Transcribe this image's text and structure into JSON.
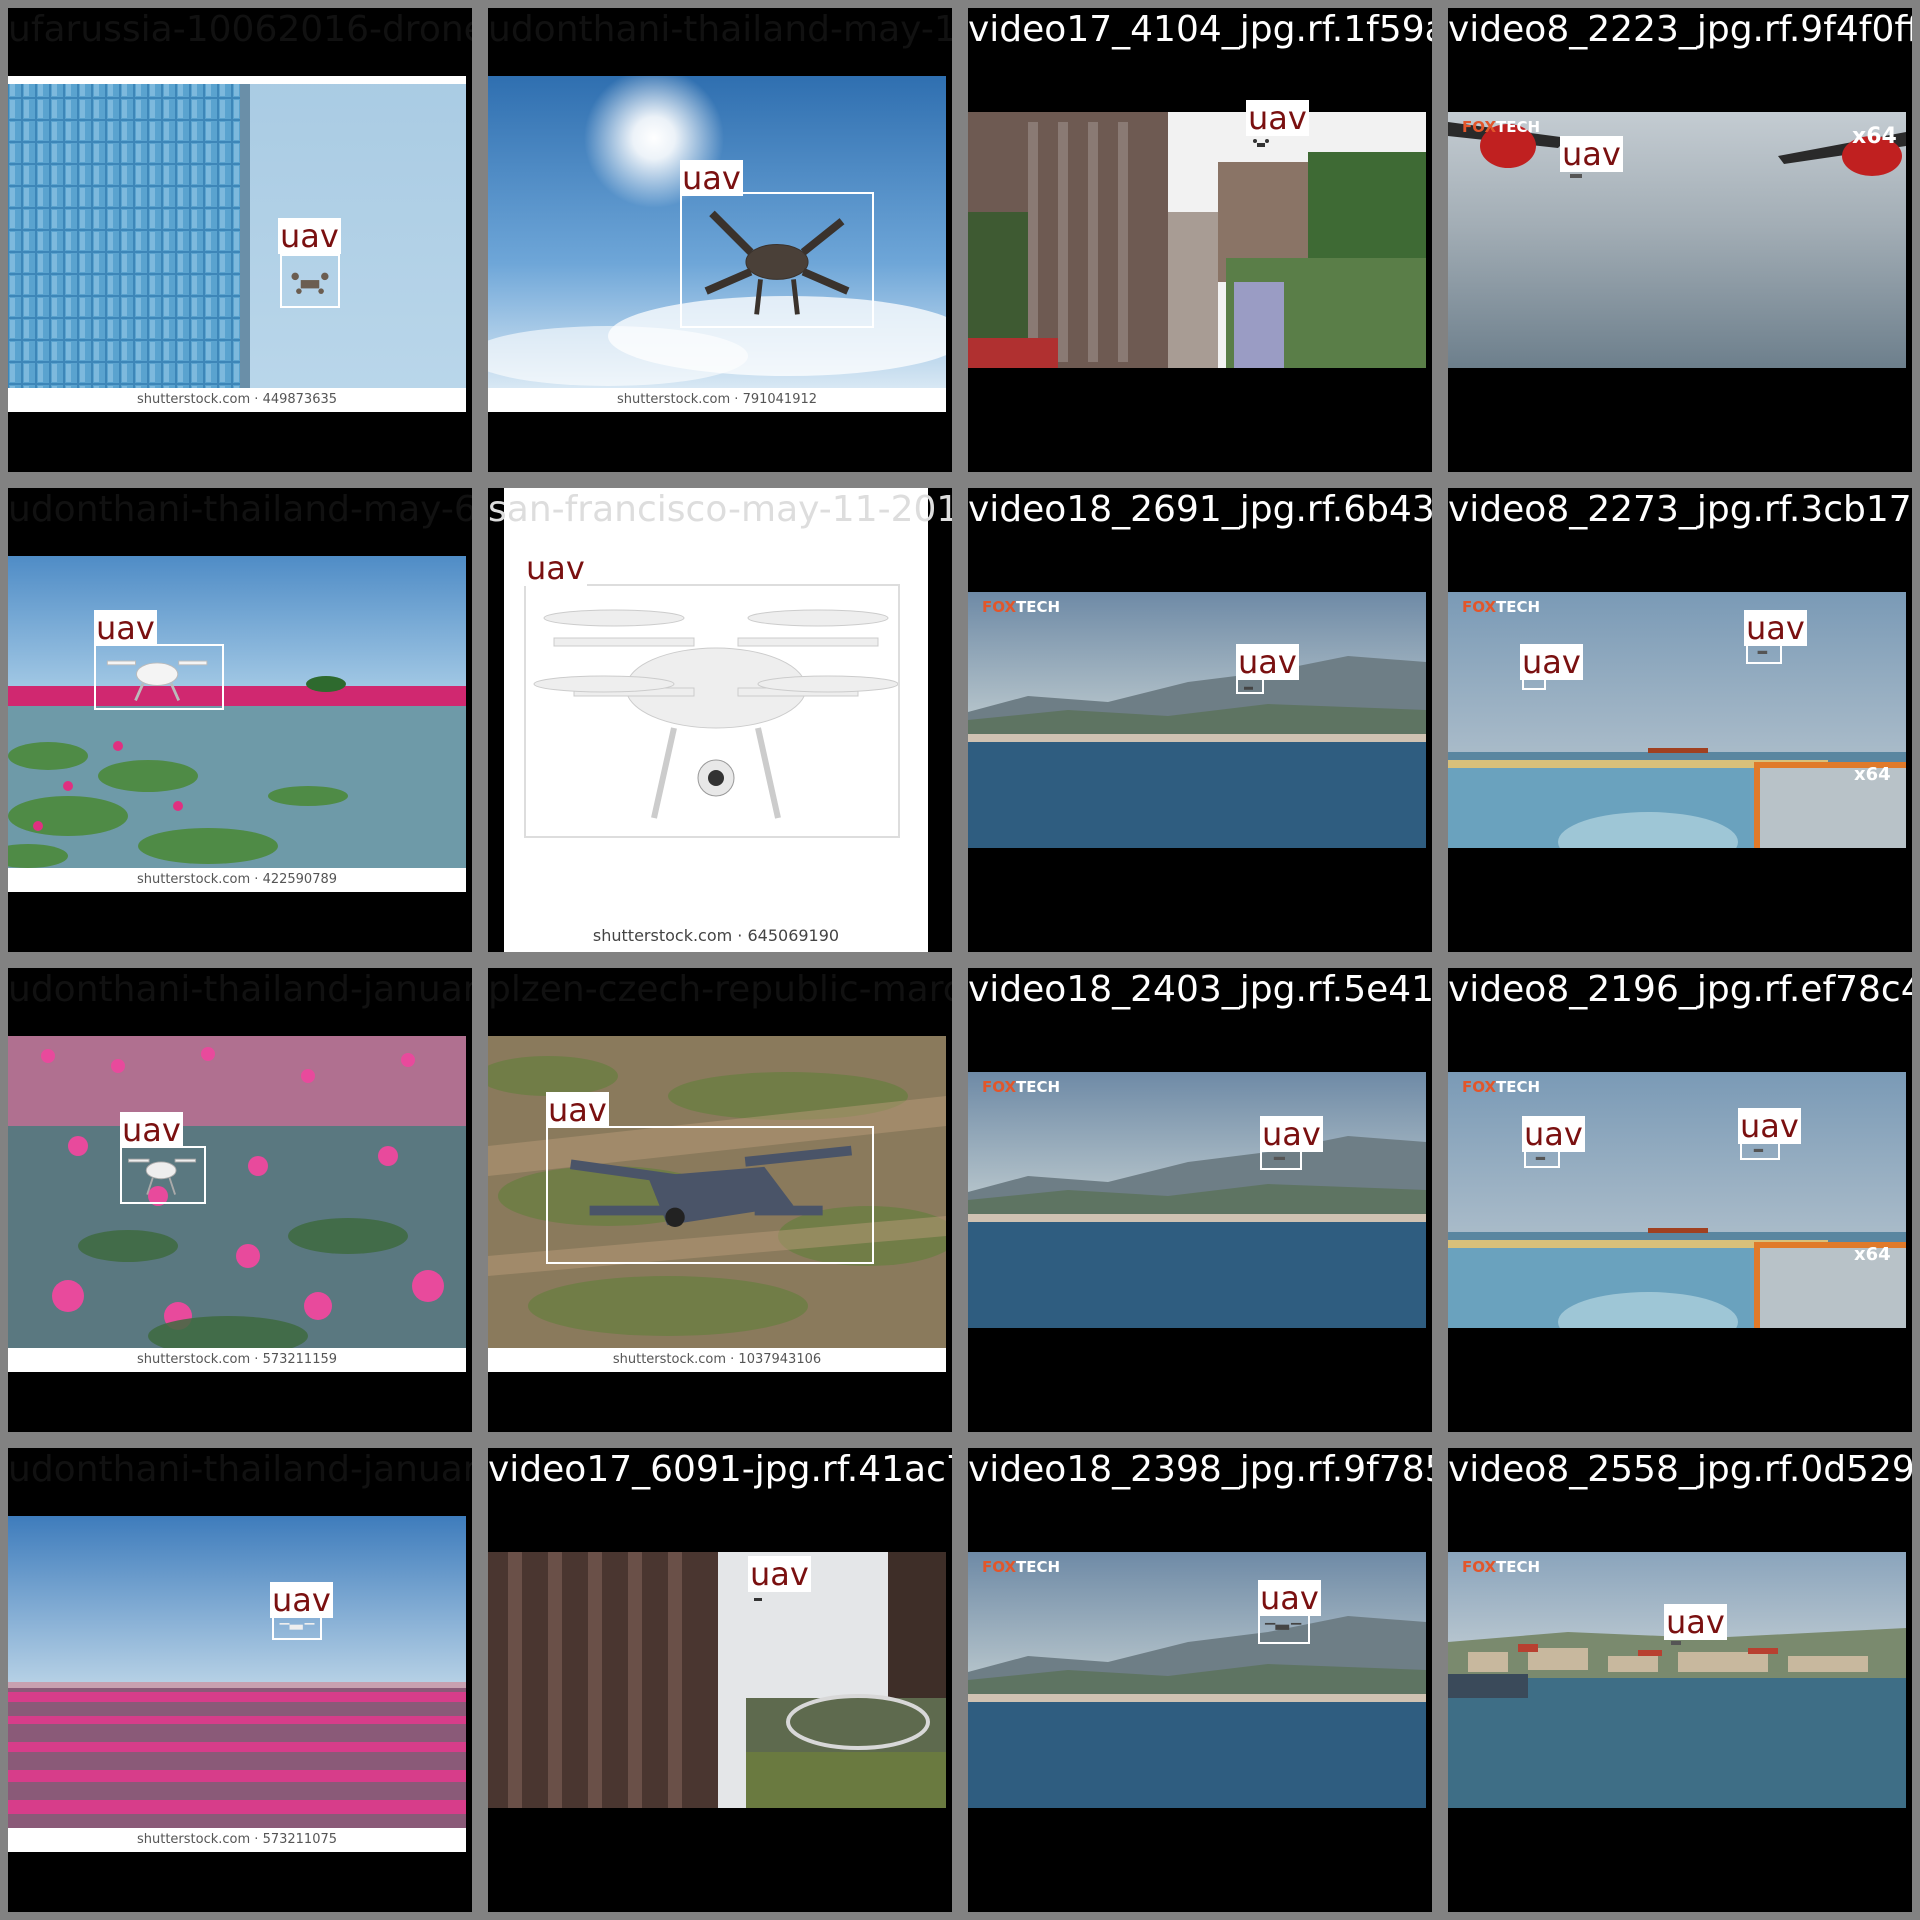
{
  "detection_label": "uav",
  "credit_prefix": "shutterstock.com",
  "logo": {
    "fox": "FOX",
    "tech": "TECH"
  },
  "zoom_badge": "x64",
  "colors": {
    "tile_border": "#828282",
    "box": "#ffffff",
    "label_text": "#7a1010"
  },
  "tiles": [
    {
      "filename": "ufarussia-10062016-drone-flying-near-28",
      "credit": "shutterstock.com · 449873635"
    },
    {
      "filename": "udonthani-thailand-may-18-2016-791041912",
      "credit": "shutterstock.com · 791041912"
    },
    {
      "filename": "video17_4104_jpg.rf.1f59a08",
      "credit": ""
    },
    {
      "filename": "video8_2223_jpg.rf.9f4f0ff0",
      "credit": ""
    },
    {
      "filename": "udonthani-thailand-may-6-2016-422590789",
      "credit": "shutterstock.com · 422590789"
    },
    {
      "filename": "san-francisco-may-11-2017-645069190",
      "credit": "shutterstock.com · 645069190"
    },
    {
      "filename": "video18_2691_jpg.rf.6b4349",
      "credit": ""
    },
    {
      "filename": "video8_2273_jpg.rf.3cb17fe",
      "credit": ""
    },
    {
      "filename": "udonthani-thailand-january-8-2017",
      "credit": "shutterstock.com · 573211159"
    },
    {
      "filename": "plzen-czech-republic-march-03-2018",
      "credit": "shutterstock.com · 1037943106"
    },
    {
      "filename": "video18_2403_jpg.rf.5e417a",
      "credit": ""
    },
    {
      "filename": "video8_2196_jpg.rf.ef78c4f",
      "credit": ""
    },
    {
      "filename": "udonthani-thailand-january-8-2017",
      "credit": "shutterstock.com · 573211075"
    },
    {
      "filename": "video17_6091-jpg.rf.41ac70f7",
      "credit": ""
    },
    {
      "filename": "video18_2398_jpg.rf.9f785e",
      "credit": ""
    },
    {
      "filename": "video8_2558_jpg.rf.0d5296",
      "credit": ""
    }
  ]
}
